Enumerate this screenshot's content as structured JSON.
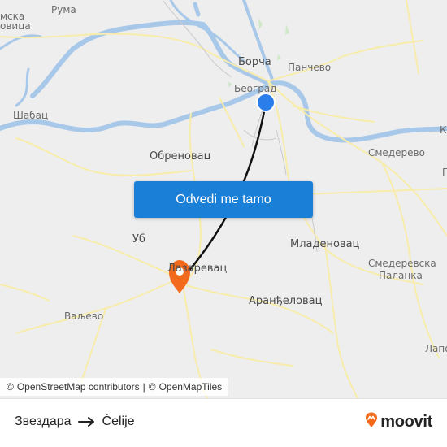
{
  "map": {
    "cta_label": "Odvedi me tamo",
    "attribution": {
      "copy1": "©",
      "osm": "OpenStreetMap contributors",
      "sep": "|",
      "copy2": "©",
      "tiles": "OpenMapTiles"
    },
    "places": {
      "ruma": "Рума",
      "ovica": "овица",
      "mska": "мска",
      "borca": "Борча",
      "pancevo": "Панчево",
      "beograd": "Београд",
      "sabac": "Шабац",
      "obrenovac": "Обреновац",
      "smederevo": "Смедерево",
      "ub": "Уб",
      "mladenovac": "Младеновац",
      "smed_palanka_1": "Смедеревска",
      "smed_palanka_2": "Паланка",
      "lazarevac": "Лазаревац",
      "arandjelovac": "Аранђеловац",
      "valjevo": "Ваљево",
      "edge_k": "К",
      "edge_p": "П",
      "edge_lap": "Лапо"
    },
    "colors": {
      "land": "#eeeeee",
      "water": "#a8c8ea",
      "road": "#f7ecaa",
      "route_line": "#111111",
      "origin": "#2b7de9",
      "destination": "#f26b1d",
      "cta": "#1a7fd6"
    }
  },
  "footer": {
    "origin": "Звездара",
    "destination": "Ćelije",
    "brand": "moovit",
    "arrow_icon": "arrow-right-icon",
    "brand_icon": "moovit-pin-icon"
  }
}
